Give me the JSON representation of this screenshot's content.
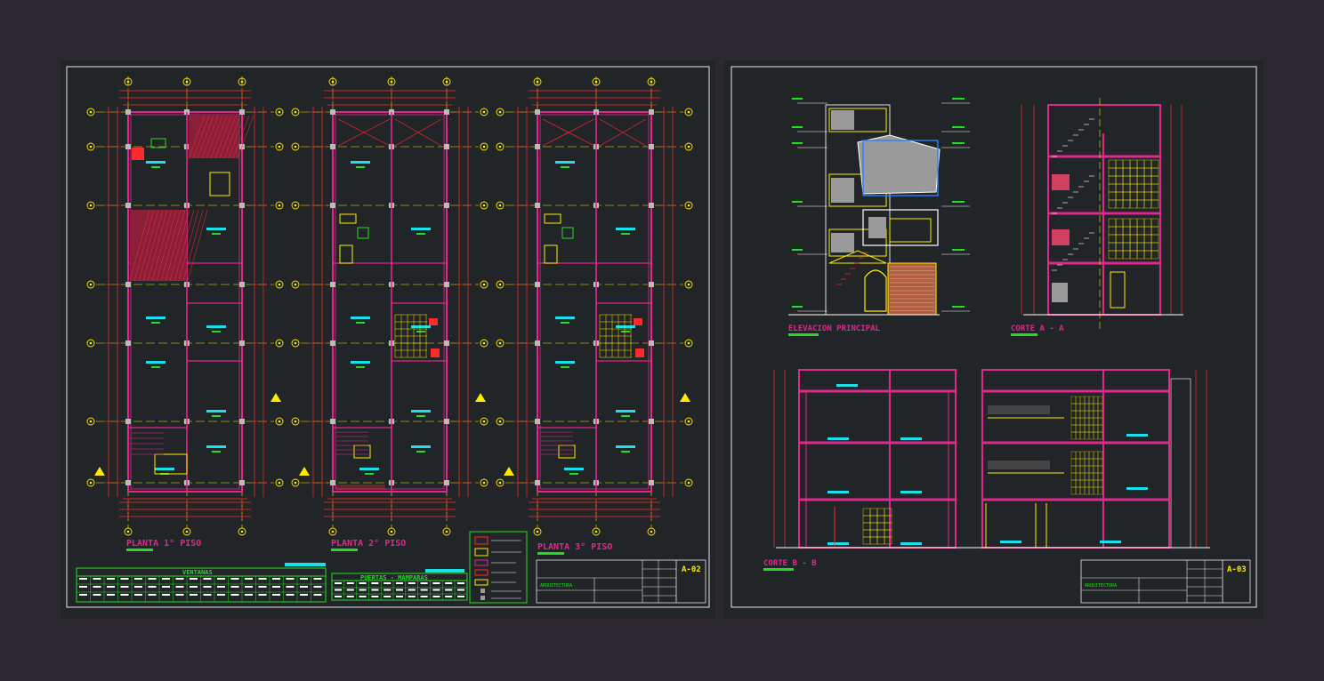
{
  "colors": {
    "background": "#2b2830",
    "sheet": "#212528",
    "border": "#e8e8e8",
    "wall": "#e0288c",
    "structure": "#ff2a2a",
    "grid": "#ffea00",
    "text": "#19e0ea",
    "green": "#22dd22",
    "white": "#ffffff"
  },
  "sheet_left": {
    "plans": [
      {
        "title": "PLANTA 1° PISO"
      },
      {
        "title": "PLANTA 2° PISO"
      },
      {
        "title": "PLANTA 3° PISO"
      }
    ],
    "tables": {
      "ventanas": "VENTANAS",
      "puertas": "PUERTAS - MAMPARAS"
    },
    "titleblock": {
      "project": "ARQUITECTURA",
      "code": "A-02"
    }
  },
  "sheet_right": {
    "views": [
      {
        "title": "ELEVACION PRINCIPAL"
      },
      {
        "title": "CORTE A - A"
      },
      {
        "title": "CORTE B - B"
      }
    ],
    "titleblock": {
      "project": "ARQUITECTURA",
      "code": "A-03"
    }
  }
}
